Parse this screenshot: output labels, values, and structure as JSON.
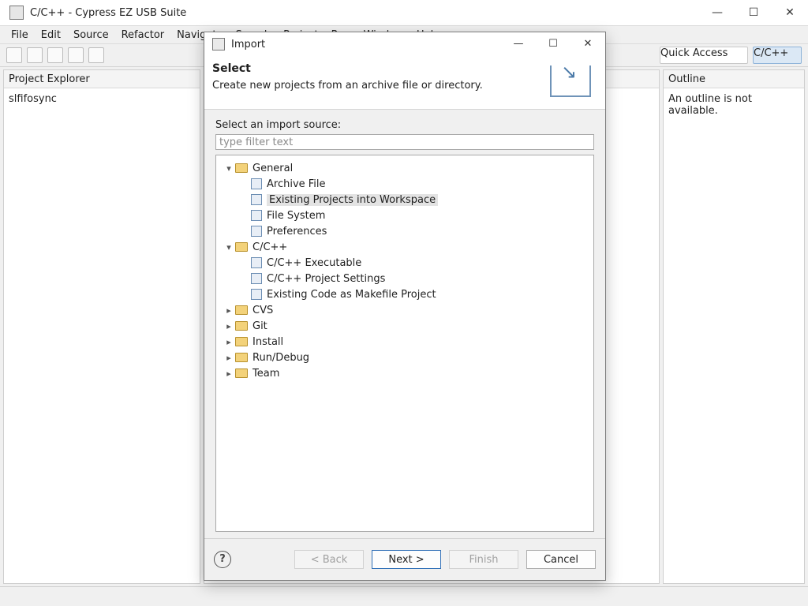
{
  "window": {
    "title": "C/C++ - Cypress EZ USB Suite",
    "menu": [
      "File",
      "Edit",
      "Source",
      "Refactor",
      "Navigate",
      "Search",
      "Project",
      "Run",
      "Window",
      "Help"
    ],
    "quick_access_label": "Quick Access",
    "perspective_label": "C/C++"
  },
  "panes": {
    "explorer_title": "Project Explorer",
    "explorer_items": [
      "slfifosync"
    ],
    "outline_title": "Outline",
    "outline_message": "An outline is not available."
  },
  "dialog": {
    "title": "Import",
    "banner_title": "Select",
    "banner_subtitle": "Create new projects from an archive file or directory.",
    "source_label": "Select an import source:",
    "filter_placeholder": "type filter text",
    "tree": [
      {
        "label": "General",
        "expanded": true,
        "children": [
          "Archive File",
          "Existing Projects into Workspace",
          "File System",
          "Preferences"
        ]
      },
      {
        "label": "C/C++",
        "expanded": true,
        "children": [
          "C/C++ Executable",
          "C/C++ Project Settings",
          "Existing Code as Makefile Project"
        ]
      },
      {
        "label": "CVS",
        "expanded": false,
        "children": []
      },
      {
        "label": "Git",
        "expanded": false,
        "children": []
      },
      {
        "label": "Install",
        "expanded": false,
        "children": []
      },
      {
        "label": "Run/Debug",
        "expanded": false,
        "children": []
      },
      {
        "label": "Team",
        "expanded": false,
        "children": []
      }
    ],
    "selected_item": "Existing Projects into Workspace",
    "buttons": {
      "back": "< Back",
      "next": "Next >",
      "finish": "Finish",
      "cancel": "Cancel"
    }
  },
  "watermark": ""
}
